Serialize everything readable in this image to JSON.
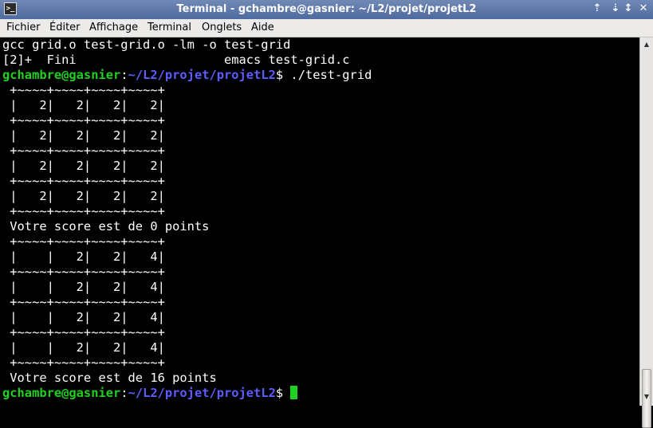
{
  "window": {
    "title": "Terminal - gchambre@gasnier: ~/L2/projet/projetL2",
    "icon": ">_",
    "controls": {
      "pin": "⇡",
      "minimize": "⇣",
      "maximize": "↕",
      "close": "✕"
    }
  },
  "menu": {
    "file": "Fichier",
    "edit": "Éditer",
    "view": "Affichage",
    "terminal": "Terminal",
    "tabs": "Onglets",
    "help": "Aide"
  },
  "terminal": {
    "prompt_user": "gchambre@gasnier",
    "prompt_sep": ":",
    "prompt_path": "~/L2/projet/projetL2",
    "prompt_symbol": "$ ",
    "command": "./test-grid",
    "lines_before": [
      "gcc grid.o test-grid.o -lm -o test-grid",
      "[2]+  Fini                    emacs test-grid.c"
    ],
    "output": [
      " +~~~~+~~~~+~~~~+~~~~+",
      " |   2|   2|   2|   2|",
      " +~~~~+~~~~+~~~~+~~~~+",
      " |   2|   2|   2|   2|",
      " +~~~~+~~~~+~~~~+~~~~+",
      " |   2|   2|   2|   2|",
      " +~~~~+~~~~+~~~~+~~~~+",
      " |   2|   2|   2|   2|",
      " +~~~~+~~~~+~~~~+~~~~+",
      " Votre score est de 0 points",
      " +~~~~+~~~~+~~~~+~~~~+",
      " |    |   2|   2|   4|",
      " +~~~~+~~~~+~~~~+~~~~+",
      " |    |   2|   2|   4|",
      " +~~~~+~~~~+~~~~+~~~~+",
      " |    |   2|   2|   4|",
      " +~~~~+~~~~+~~~~+~~~~+",
      " |    |   2|   2|   4|",
      " +~~~~+~~~~+~~~~+~~~~+",
      " Votre score est de 16 points"
    ]
  },
  "scrollbar": {
    "up": "▲",
    "down": "▼"
  },
  "colors": {
    "prompt_user": "#20d020",
    "prompt_path": "#5c5cff",
    "titlebar": "#5f78a9"
  }
}
